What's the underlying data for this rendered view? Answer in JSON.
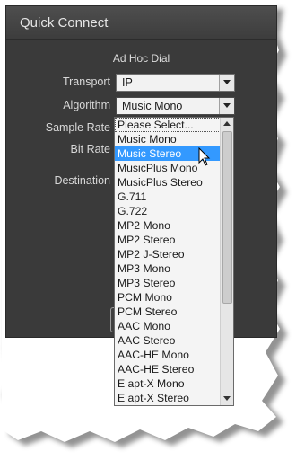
{
  "panel": {
    "title": "Quick Connect",
    "section_title": "Ad Hoc Dial"
  },
  "fields": {
    "transport": {
      "label": "Transport",
      "value": "IP"
    },
    "algorithm": {
      "label": "Algorithm",
      "value": "Music Mono"
    },
    "sample_rate": {
      "label": "Sample Rate"
    },
    "bit_rate": {
      "label": "Bit Rate"
    },
    "destination": {
      "label": "Destination"
    }
  },
  "dropdown": {
    "selected_index": 2,
    "items": [
      "Please Select...",
      "Music Mono",
      "Music Stereo",
      "MusicPlus Mono",
      "MusicPlus Stereo",
      "G.711",
      "G.722",
      "MP2 Mono",
      "MP2 Stereo",
      "MP2 J-Stereo",
      "MP3 Mono",
      "MP3 Stereo",
      "PCM Mono",
      "PCM Stereo",
      "AAC Mono",
      "AAC Stereo",
      "AAC-HE Mono",
      "AAC-HE Stereo",
      "E apt-X Mono",
      "E apt-X Stereo"
    ]
  },
  "colors": {
    "panel_bg": "#3a3a3a",
    "highlight": "#3399ff"
  }
}
